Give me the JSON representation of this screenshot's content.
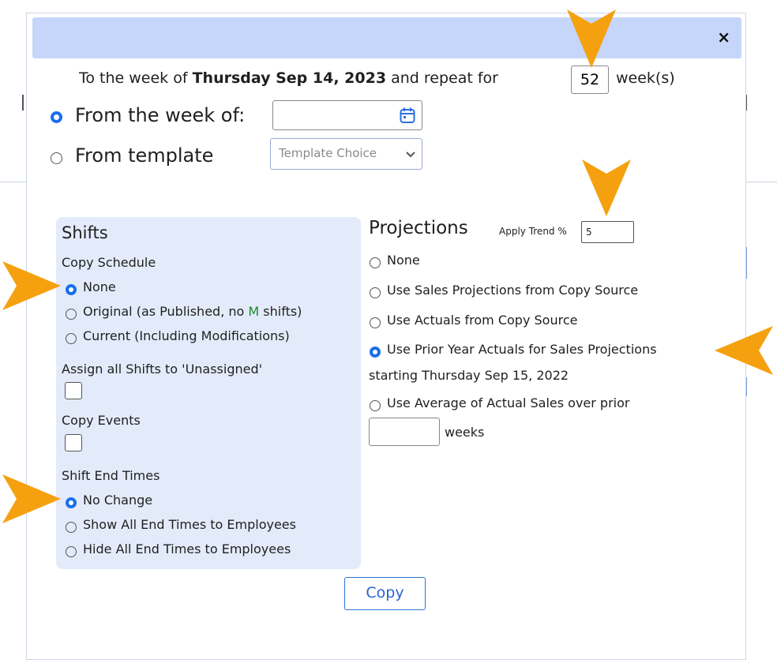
{
  "dialog": {
    "close_label": "×",
    "repeat": {
      "prefix": "To the week of ",
      "date": "Thursday Sep 14, 2023",
      "middle": " and repeat for ",
      "weeks_value": "52",
      "suffix": "week(s)"
    },
    "source": {
      "from_week_label": "From the week of:",
      "from_week_value": "",
      "from_template_label": "From template",
      "template_placeholder": "Template Choice",
      "selected": "from_week"
    },
    "shifts": {
      "title": "Shifts",
      "copy_schedule_label": "Copy Schedule",
      "options": [
        "None",
        "Original (as Published, no ",
        "M",
        " shifts)",
        "Current (Including Modifications)"
      ],
      "assign_unassigned_label": "Assign all Shifts to 'Unassigned'",
      "copy_events_label": "Copy Events",
      "end_times_label": "Shift End Times",
      "end_options": [
        "No Change",
        "Show All End Times to Employees",
        "Hide All End Times to Employees"
      ]
    },
    "projections": {
      "title": "Projections",
      "apply_trend_label": "Apply Trend %",
      "apply_trend_value": "5",
      "options": [
        "None",
        "Use Sales Projections from Copy Source",
        "Use Actuals from Copy Source",
        "Use Prior Year Actuals for Sales Projections",
        "Use Average of Actual Sales over prior"
      ],
      "prior_year_sub": "starting Thursday Sep 15, 2022",
      "weeks_label": "weeks",
      "weeks_value": ""
    },
    "copy_button_label": "Copy"
  },
  "colors": {
    "titlebar": "#c6d6fb",
    "panel": "#e3ebfa",
    "accent": "#1a6ef0",
    "arrow": "#f5a10f"
  }
}
